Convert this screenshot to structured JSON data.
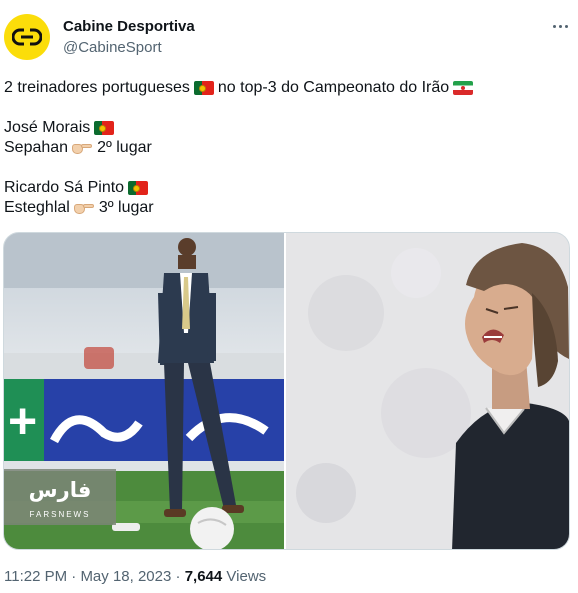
{
  "author": {
    "name": "Cabine Desportiva",
    "handle": "@CabineSport",
    "brand_color": "#fbdd0a"
  },
  "tweet": {
    "line1_start": "2 treinadores portugueses",
    "line1_end": "no top-3 do Campeonato do Irão",
    "coach1_name": "José Morais",
    "coach1_team": "Sepahan",
    "coach1_place": "2º lugar",
    "coach2_name": "Ricardo Sá Pinto",
    "coach2_team": "Esteghlal",
    "coach2_place": "3º lugar",
    "flags": [
      "portugal-flag",
      "iran-flag"
    ],
    "emoji": "backhand-index-pointing-right"
  },
  "media": {
    "watermark_brand": "فارس",
    "watermark_sub": "FARSNEWS"
  },
  "meta": {
    "time": "11:22 PM",
    "separator": "·",
    "date": "May 18, 2023",
    "views_count": "7,644",
    "views_label": "Views"
  }
}
